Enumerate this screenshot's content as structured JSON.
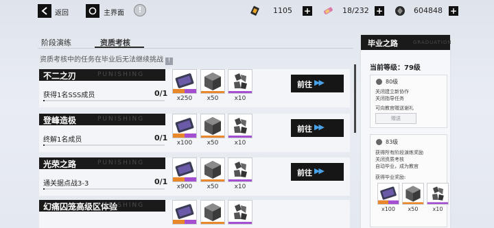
{
  "topbar": {
    "back_label": "返回",
    "home_label": "主界面",
    "info_icon": "!",
    "resources": [
      {
        "name": "stamina-battery",
        "value": "1105"
      },
      {
        "name": "energy-ticket",
        "value": "18/232"
      },
      {
        "name": "coin",
        "value": "604848"
      }
    ]
  },
  "tabs": [
    {
      "label": "阶段演练",
      "active": false
    },
    {
      "label": "资质考核",
      "active": true
    }
  ],
  "notice": "资质考核中的任务在毕业后无法继续挑战",
  "notice_mark": "!",
  "watermark": "PUNISHING",
  "go_label": "前往",
  "go_arrows": "▶▶",
  "tasks": [
    {
      "title": "不二之刃",
      "desc": "获得1名SSS成员",
      "progress": "0/1",
      "progress_value": 0.0,
      "rewards": [
        {
          "icon": "ticket",
          "qty": "x250"
        },
        {
          "icon": "chip-box",
          "qty": "x50"
        },
        {
          "icon": "crystal-ore",
          "qty": "x10"
        }
      ]
    },
    {
      "title": "登峰造极",
      "desc": "终解1名成员",
      "progress": "0/1",
      "progress_value": 0.0,
      "rewards": [
        {
          "icon": "ticket",
          "qty": "x100"
        },
        {
          "icon": "chip-box",
          "qty": "x50"
        },
        {
          "icon": "crystal-ore",
          "qty": "x10"
        }
      ]
    },
    {
      "title": "光荣之路",
      "desc": "通关据点战3-3",
      "progress": "0/1",
      "progress_value": 0.0,
      "rewards": [
        {
          "icon": "ticket",
          "qty": "x900"
        },
        {
          "icon": "chip-box",
          "qty": "x50"
        },
        {
          "icon": "crystal-ore",
          "qty": "x10"
        }
      ]
    },
    {
      "title": "幻痛囚笼高级区体验",
      "desc": "",
      "progress": "",
      "progress_value": 0.0,
      "rewards": [
        {
          "icon": "ticket",
          "qty": ""
        },
        {
          "icon": "chip-box",
          "qty": ""
        },
        {
          "icon": "crystal-ore",
          "qty": ""
        }
      ]
    }
  ],
  "panel": {
    "title": "毕业之路",
    "watermark": "GRADUATION",
    "level_label": "当前等级：79级",
    "milestones": [
      {
        "level": "80级",
        "lines": [
          "关闭建立新协作",
          "关闭指导任务"
        ],
        "extra": "可向教官赠送谢礼",
        "button": "赠送"
      },
      {
        "level": "83级",
        "lines": [
          "获得所有阶段演练奖励",
          "关闭资质考核",
          "自动毕业，成为教官"
        ],
        "extra": "获得毕业奖励:",
        "button": ""
      }
    ],
    "grad_rewards": [
      {
        "icon": "ticket",
        "qty": "x100"
      },
      {
        "icon": "chip-box",
        "qty": "x50"
      },
      {
        "icon": "crystal-ore",
        "qty": "x10"
      }
    ]
  },
  "colors": {
    "accent": "#4aa3e8",
    "dark": "#161616",
    "ticket_orange": "#e8882a",
    "ticket_purple": "#a34fd0"
  }
}
